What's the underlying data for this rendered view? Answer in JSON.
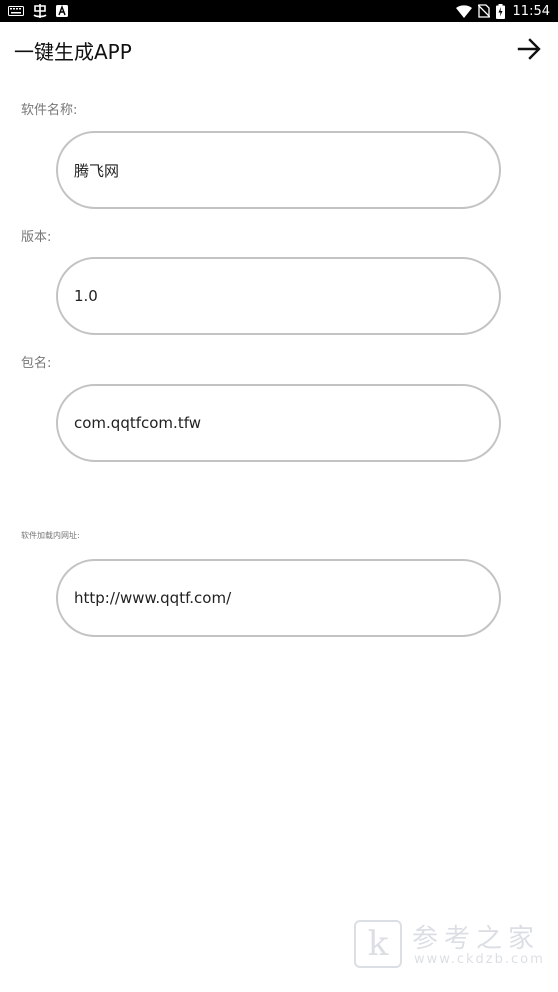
{
  "status_bar": {
    "time": "11:54",
    "left_icons": [
      "keyboard-icon",
      "app-notification-icon",
      "a-box-icon"
    ],
    "right_icons": [
      "wifi-icon",
      "no-sim-icon",
      "battery-charging-icon"
    ]
  },
  "app_bar": {
    "title": "一键生成APP",
    "action_icon": "arrow-forward-icon"
  },
  "form": {
    "app_name": {
      "label": "软件名称:",
      "value": "腾飞网"
    },
    "version": {
      "label": "版本:",
      "value": "1.0"
    },
    "package": {
      "label": "包名:",
      "value": "com.qqtfcom.tfw"
    },
    "url": {
      "label": "软件加载内网址:",
      "value": "http://www.qqtf.com/"
    }
  },
  "watermark": {
    "logo_letter": "k",
    "text": "参考之家",
    "url": "www.ckdzb.com"
  }
}
